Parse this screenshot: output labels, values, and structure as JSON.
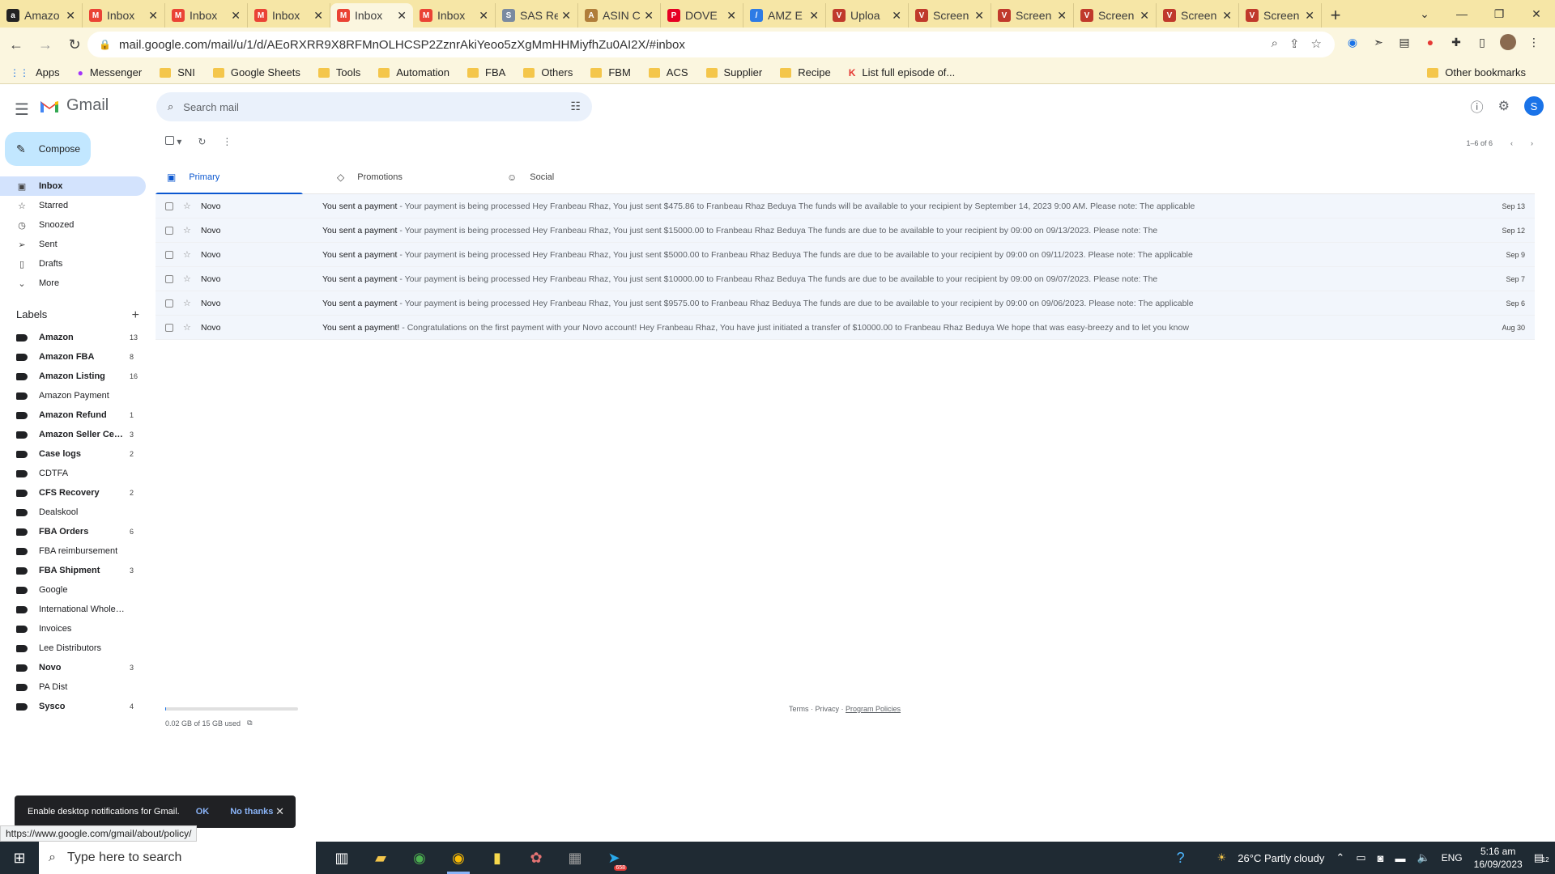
{
  "browser": {
    "tabs": [
      {
        "title": "Amazo",
        "icon": "amazon-icon",
        "color": "#222222",
        "glyph": "a",
        "active": false
      },
      {
        "title": "Inbox",
        "icon": "gmail-icon",
        "color": "#ea4335",
        "glyph": "M",
        "active": false
      },
      {
        "title": "Inbox",
        "icon": "gmail-icon",
        "color": "#ea4335",
        "glyph": "M",
        "active": false
      },
      {
        "title": "Inbox",
        "icon": "gmail-icon",
        "color": "#ea4335",
        "glyph": "M",
        "active": false
      },
      {
        "title": "Inbox",
        "icon": "gmail-icon",
        "color": "#ea4335",
        "glyph": "M",
        "active": true
      },
      {
        "title": "Inbox",
        "icon": "gmail-icon",
        "color": "#ea4335",
        "glyph": "M",
        "active": false
      },
      {
        "title": "SAS Re",
        "icon": "sas-icon",
        "color": "#7a8aa0",
        "glyph": "S",
        "active": false
      },
      {
        "title": "ASIN C",
        "icon": "asin-icon",
        "color": "#b07d3a",
        "glyph": "A",
        "active": false
      },
      {
        "title": "DOVE",
        "icon": "pinterest-icon",
        "color": "#e60023",
        "glyph": "P",
        "active": false
      },
      {
        "title": "AMZ E",
        "icon": "pencil-icon",
        "color": "#2d7be5",
        "glyph": "/",
        "active": false
      },
      {
        "title": "Uploa",
        "icon": "triangle-logo-icon",
        "color": "#c0392b",
        "glyph": "V",
        "active": false
      },
      {
        "title": "Screen",
        "icon": "triangle-logo-icon",
        "color": "#c0392b",
        "glyph": "V",
        "active": false
      },
      {
        "title": "Screen",
        "icon": "triangle-logo-icon",
        "color": "#c0392b",
        "glyph": "V",
        "active": false
      },
      {
        "title": "Screen",
        "icon": "triangle-logo-icon",
        "color": "#c0392b",
        "glyph": "V",
        "active": false
      },
      {
        "title": "Screen",
        "icon": "triangle-logo-icon",
        "color": "#c0392b",
        "glyph": "V",
        "active": false
      },
      {
        "title": "Screen",
        "icon": "triangle-logo-icon",
        "color": "#c0392b",
        "glyph": "V",
        "active": false
      }
    ],
    "url": "mail.google.com/mail/u/1/d/AEoRXRR9X8RFMnOLHCSP2ZznrAkiYeoo5zXgMmHHMiyfhZu0AI2X/#inbox",
    "bookmarks": [
      {
        "label": "Apps",
        "kind": "apps"
      },
      {
        "label": "Messenger",
        "kind": "messenger"
      },
      {
        "label": "SNI",
        "kind": "folder"
      },
      {
        "label": "Google Sheets",
        "kind": "folder"
      },
      {
        "label": "Tools",
        "kind": "folder"
      },
      {
        "label": "Automation",
        "kind": "folder"
      },
      {
        "label": "FBA",
        "kind": "folder"
      },
      {
        "label": "Others",
        "kind": "folder"
      },
      {
        "label": "FBM",
        "kind": "folder"
      },
      {
        "label": "ACS",
        "kind": "folder"
      },
      {
        "label": "Supplier",
        "kind": "folder"
      },
      {
        "label": "Recipe",
        "kind": "folder"
      },
      {
        "label": "List full episode of...",
        "kind": "link"
      }
    ],
    "other_bookmarks": "Other bookmarks"
  },
  "gmail": {
    "brand": "Gmail",
    "search_placeholder": "Search mail",
    "avatar_letter": "S",
    "compose": "Compose",
    "nav": [
      {
        "label": "Inbox",
        "icon": "inbox-icon",
        "glyph": "▣",
        "active": true
      },
      {
        "label": "Starred",
        "icon": "star-icon",
        "glyph": "☆",
        "active": false
      },
      {
        "label": "Snoozed",
        "icon": "clock-icon",
        "glyph": "◷",
        "active": false
      },
      {
        "label": "Sent",
        "icon": "send-icon",
        "glyph": "➢",
        "active": false
      },
      {
        "label": "Drafts",
        "icon": "draft-icon",
        "glyph": "▯",
        "active": false
      },
      {
        "label": "More",
        "icon": "chevron-down-icon",
        "glyph": "⌄",
        "active": false
      }
    ],
    "labels_title": "Labels",
    "labels": [
      {
        "name": "Amazon",
        "count": "13",
        "bold": true
      },
      {
        "name": "Amazon FBA",
        "count": "8",
        "bold": true
      },
      {
        "name": "Amazon Listing",
        "count": "16",
        "bold": true
      },
      {
        "name": "Amazon Payment",
        "count": "",
        "bold": false
      },
      {
        "name": "Amazon Refund",
        "count": "1",
        "bold": true
      },
      {
        "name": "Amazon Seller Cen...",
        "count": "3",
        "bold": true
      },
      {
        "name": "Case logs",
        "count": "2",
        "bold": true
      },
      {
        "name": "CDTFA",
        "count": "",
        "bold": false
      },
      {
        "name": "CFS Recovery",
        "count": "2",
        "bold": true
      },
      {
        "name": "Dealskool",
        "count": "",
        "bold": false
      },
      {
        "name": "FBA Orders",
        "count": "6",
        "bold": true
      },
      {
        "name": "FBA reimbursement",
        "count": "",
        "bold": false
      },
      {
        "name": "FBA Shipment",
        "count": "3",
        "bold": true
      },
      {
        "name": "Google",
        "count": "",
        "bold": false
      },
      {
        "name": "International Wholesale",
        "count": "",
        "bold": false
      },
      {
        "name": "Invoices",
        "count": "",
        "bold": false
      },
      {
        "name": "Lee Distributors",
        "count": "",
        "bold": false
      },
      {
        "name": "Novo",
        "count": "3",
        "bold": true
      },
      {
        "name": "PA Dist",
        "count": "",
        "bold": false
      },
      {
        "name": "Sysco",
        "count": "4",
        "bold": true
      }
    ],
    "pager": "1–6 of 6",
    "tabs": [
      {
        "label": "Primary",
        "icon": "inbox-icon",
        "glyph": "▣",
        "active": true
      },
      {
        "label": "Promotions",
        "icon": "tag-icon",
        "glyph": "◇",
        "active": false
      },
      {
        "label": "Social",
        "icon": "people-icon",
        "glyph": "☺",
        "active": false
      }
    ],
    "emails": [
      {
        "sender": "Novo",
        "subject": "You sent a payment",
        "snippet": " - Your payment is being processed Hey Franbeau Rhaz, You just sent $475.86 to Franbeau Rhaz Beduya The funds will be available to your recipient by September 14, 2023 9:00 AM. Please note: The applicable",
        "date": "Sep 13"
      },
      {
        "sender": "Novo",
        "subject": "You sent a payment",
        "snippet": " - Your payment is being processed Hey Franbeau Rhaz, You just sent $15000.00 to Franbeau Rhaz Beduya The funds are due to be available to your recipient by 09:00 on 09/13/2023. Please note: The",
        "date": "Sep 12"
      },
      {
        "sender": "Novo",
        "subject": "You sent a payment",
        "snippet": " - Your payment is being processed Hey Franbeau Rhaz, You just sent $5000.00 to Franbeau Rhaz Beduya The funds are due to be available to your recipient by 09:00 on 09/11/2023. Please note: The applicable",
        "date": "Sep 9"
      },
      {
        "sender": "Novo",
        "subject": "You sent a payment",
        "snippet": " - Your payment is being processed Hey Franbeau Rhaz, You just sent $10000.00 to Franbeau Rhaz Beduya The funds are due to be available to your recipient by 09:00 on 09/07/2023. Please note: The",
        "date": "Sep 7"
      },
      {
        "sender": "Novo",
        "subject": "You sent a payment",
        "snippet": " - Your payment is being processed Hey Franbeau Rhaz, You just sent $9575.00 to Franbeau Rhaz Beduya The funds are due to be available to your recipient by 09:00 on 09/06/2023. Please note: The applicable",
        "date": "Sep 6"
      },
      {
        "sender": "Novo",
        "subject": "You sent a payment!",
        "snippet": " - Congratulations on the first payment with your Novo account! Hey Franbeau Rhaz, You have just initiated a transfer of $10000.00 to Franbeau Rhaz Beduya We hope that was easy-breezy and to let you know",
        "date": "Aug 30"
      }
    ],
    "storage": "0.02 GB of 15 GB used",
    "storage_fraction": 0.0013,
    "footer": {
      "terms": "Terms",
      "sep1": " · ",
      "privacy": "Privacy",
      "sep2": " · ",
      "policies": "Program Policies"
    },
    "snackbar": {
      "text": "Enable desktop notifications for Gmail.",
      "ok": "OK",
      "no": "No thanks"
    },
    "status_url": "https://www.google.com/gmail/about/policy/"
  },
  "taskbar": {
    "search_placeholder": "Type here to search",
    "weather": "26°C  Partly cloudy",
    "lang": "ENG",
    "time": "5:16 am",
    "date": "16/09/2023",
    "notification_count": "12",
    "telegram_badge": "658"
  }
}
